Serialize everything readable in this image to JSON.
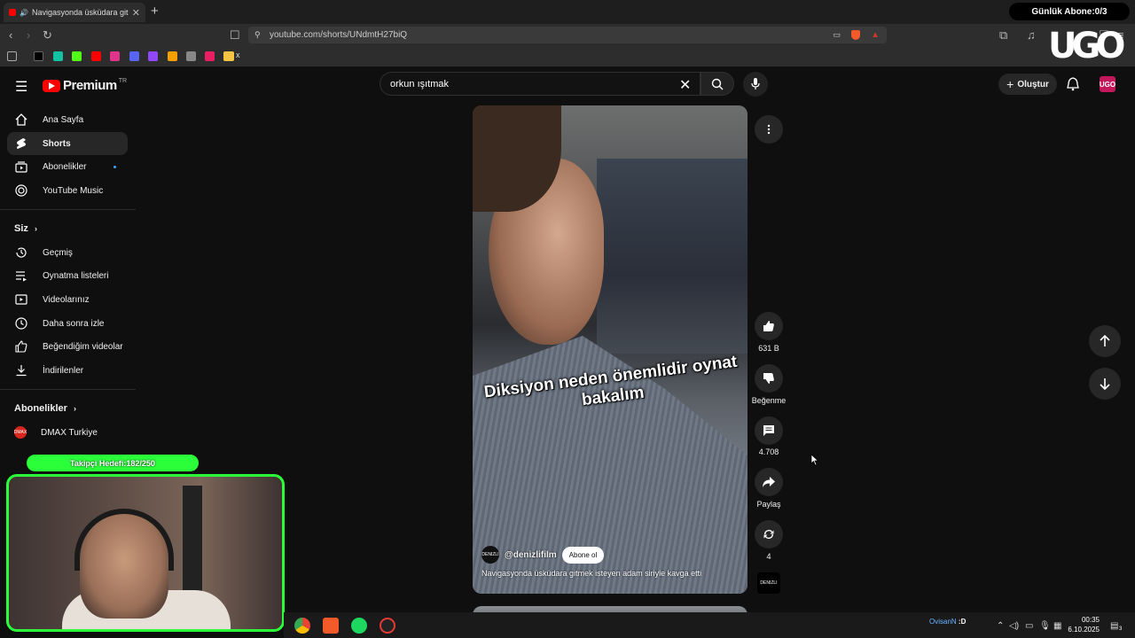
{
  "browser": {
    "tab_title": "Navigasyonda üsküdara gitm",
    "new_tab": "+",
    "url": "youtube.com/shorts/UNdmtH27biQ",
    "sub_counter": "Günlük Abone:0/3",
    "bookmark_folder": "x"
  },
  "header": {
    "logo_text": "Premium",
    "logo_region": "TR",
    "search_value": "orkun ışıtmak",
    "create_label": "Oluştur",
    "avatar_text": "UGO"
  },
  "sidebar": {
    "main": [
      {
        "label": "Ana Sayfa",
        "icon": "home-icon"
      },
      {
        "label": "Shorts",
        "icon": "shorts-icon"
      },
      {
        "label": "Abonelikler",
        "icon": "subscriptions-icon"
      },
      {
        "label": "YouTube Music",
        "icon": "music-icon"
      }
    ],
    "you_header": "Siz",
    "you": [
      {
        "label": "Geçmiş",
        "icon": "history-icon"
      },
      {
        "label": "Oynatma listeleri",
        "icon": "playlist-icon"
      },
      {
        "label": "Videolarınız",
        "icon": "your-videos-icon"
      },
      {
        "label": "Daha sonra izle",
        "icon": "watch-later-icon"
      },
      {
        "label": "Beğendiğim videolar",
        "icon": "liked-icon"
      },
      {
        "label": "İndirilenler",
        "icon": "download-icon"
      }
    ],
    "subs_header": "Abonelikler",
    "subs": [
      {
        "label": "DMAX Turkiye",
        "avatar": "DMAX"
      }
    ]
  },
  "short": {
    "caption": "Diksiyon neden önemlidir oynat bakalım",
    "channel": "@denizlifilm",
    "channel_avatar": "DENIZLI",
    "subscribe_label": "Abone ol",
    "title": "Navigasyonda üsküdara gitmek isteyen adam siriyle kavga etti"
  },
  "actions": {
    "likes": "631 B",
    "dislike_label": "Beğenme",
    "comments": "4.708",
    "share_label": "Paylaş",
    "remix_count": "4",
    "sound_avatar": "DENIZLI"
  },
  "overlay": {
    "follower_goal": "Takipçi Hedefi:182/250"
  },
  "taskbar": {
    "user": "OvisanN",
    "user_suffix": ":D",
    "time": "00:35",
    "date": "6.10.2025",
    "notif_count": "3"
  },
  "colors": {
    "youtube_red": "#ff0000",
    "overlay_green": "#2aff3a",
    "link_blue": "#3ea6ff"
  }
}
